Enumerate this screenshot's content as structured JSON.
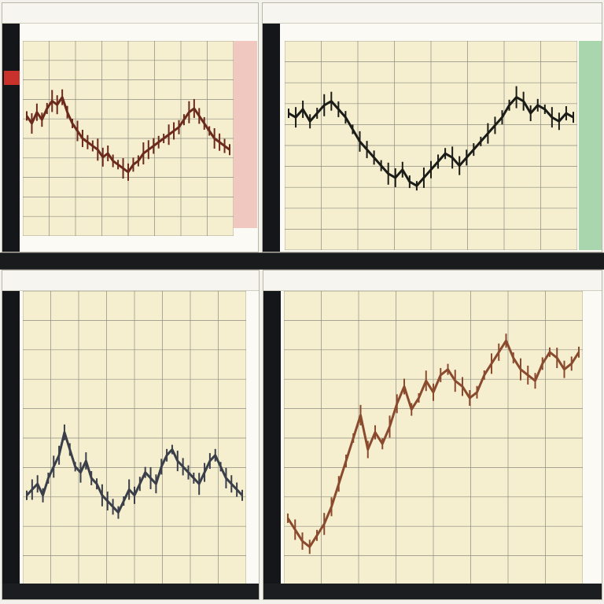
{
  "theme": {
    "plot_bg": "#f6efcf",
    "grid": "#8d8b80",
    "axis_bg": "#15161a",
    "series_colors": [
      "#6b2a1c",
      "#1b1c18",
      "#3a3f4a",
      "#8a4a2e"
    ],
    "band_colors": [
      "#f1c8bf",
      "#a9d6ad",
      "#f3c2a8",
      "#d84a30"
    ]
  },
  "chart_data": [
    {
      "type": "line",
      "title": "",
      "xlabel": "",
      "ylabel": "",
      "x": [
        0,
        1,
        2,
        3,
        4,
        5,
        6,
        7,
        8,
        9,
        10,
        11,
        12,
        13,
        14,
        15,
        16,
        17,
        18,
        19,
        20,
        21,
        22,
        23,
        24,
        25,
        26,
        27,
        28,
        29,
        30,
        31,
        32,
        33,
        34,
        35,
        36,
        37,
        38,
        39,
        40
      ],
      "series": [
        {
          "values": [
            62,
            58,
            64,
            60,
            66,
            70,
            68,
            72,
            64,
            58,
            54,
            50,
            48,
            46,
            44,
            40,
            42,
            38,
            36,
            34,
            32,
            36,
            38,
            42,
            44,
            46,
            48,
            50,
            52,
            54,
            56,
            60,
            64,
            66,
            62,
            58,
            54,
            50,
            48,
            46,
            44
          ]
        }
      ],
      "ylim": [
        0,
        100
      ],
      "grid": true
    },
    {
      "type": "line",
      "title": "",
      "xlabel": "",
      "ylabel": "",
      "x": [
        0,
        1,
        2,
        3,
        4,
        5,
        6,
        7,
        8,
        9,
        10,
        11,
        12,
        13,
        14,
        15,
        16,
        17,
        18,
        19,
        20,
        21,
        22,
        23,
        24,
        25,
        26,
        27,
        28,
        29,
        30,
        31,
        32,
        33,
        34,
        35,
        36,
        37,
        38,
        39,
        40
      ],
      "series": [
        {
          "values": [
            66,
            64,
            68,
            62,
            66,
            70,
            72,
            68,
            64,
            58,
            52,
            48,
            44,
            40,
            36,
            34,
            38,
            32,
            30,
            34,
            38,
            42,
            46,
            44,
            40,
            44,
            48,
            52,
            56,
            60,
            64,
            70,
            74,
            72,
            66,
            70,
            68,
            64,
            62,
            66,
            64
          ]
        }
      ],
      "ylim": [
        0,
        100
      ],
      "grid": true
    },
    {
      "type": "line",
      "title": "",
      "xlabel": "",
      "ylabel": "",
      "x": [
        0,
        1,
        2,
        3,
        4,
        5,
        6,
        7,
        8,
        9,
        10,
        11,
        12,
        13,
        14,
        15,
        16,
        17,
        18,
        19,
        20,
        21,
        22,
        23,
        24,
        25,
        26,
        27,
        28,
        29,
        30,
        31,
        32,
        33,
        34,
        35,
        36,
        37,
        38,
        39,
        40
      ],
      "series": [
        {
          "values": [
            30,
            32,
            34,
            30,
            36,
            40,
            44,
            52,
            46,
            40,
            38,
            42,
            36,
            34,
            30,
            28,
            26,
            24,
            28,
            32,
            30,
            34,
            38,
            36,
            34,
            40,
            44,
            46,
            42,
            40,
            38,
            36,
            34,
            38,
            42,
            44,
            40,
            36,
            34,
            32,
            30
          ]
        }
      ],
      "ylim": [
        0,
        100
      ],
      "grid": true
    },
    {
      "type": "line",
      "title": "",
      "xlabel": "",
      "ylabel": "",
      "x": [
        0,
        1,
        2,
        3,
        4,
        5,
        6,
        7,
        8,
        9,
        10,
        11,
        12,
        13,
        14,
        15,
        16,
        17,
        18,
        19,
        20,
        21,
        22,
        23,
        24,
        25,
        26,
        27,
        28,
        29,
        30,
        31,
        32,
        33,
        34,
        35,
        36,
        37,
        38,
        39,
        40
      ],
      "series": [
        {
          "values": [
            22,
            18,
            14,
            12,
            16,
            20,
            26,
            34,
            42,
            50,
            58,
            46,
            52,
            48,
            54,
            62,
            68,
            60,
            64,
            70,
            66,
            72,
            74,
            70,
            68,
            64,
            66,
            72,
            76,
            80,
            84,
            78,
            74,
            72,
            70,
            76,
            80,
            78,
            74,
            76,
            80
          ]
        }
      ],
      "ylim": [
        0,
        100
      ],
      "grid": true
    }
  ]
}
